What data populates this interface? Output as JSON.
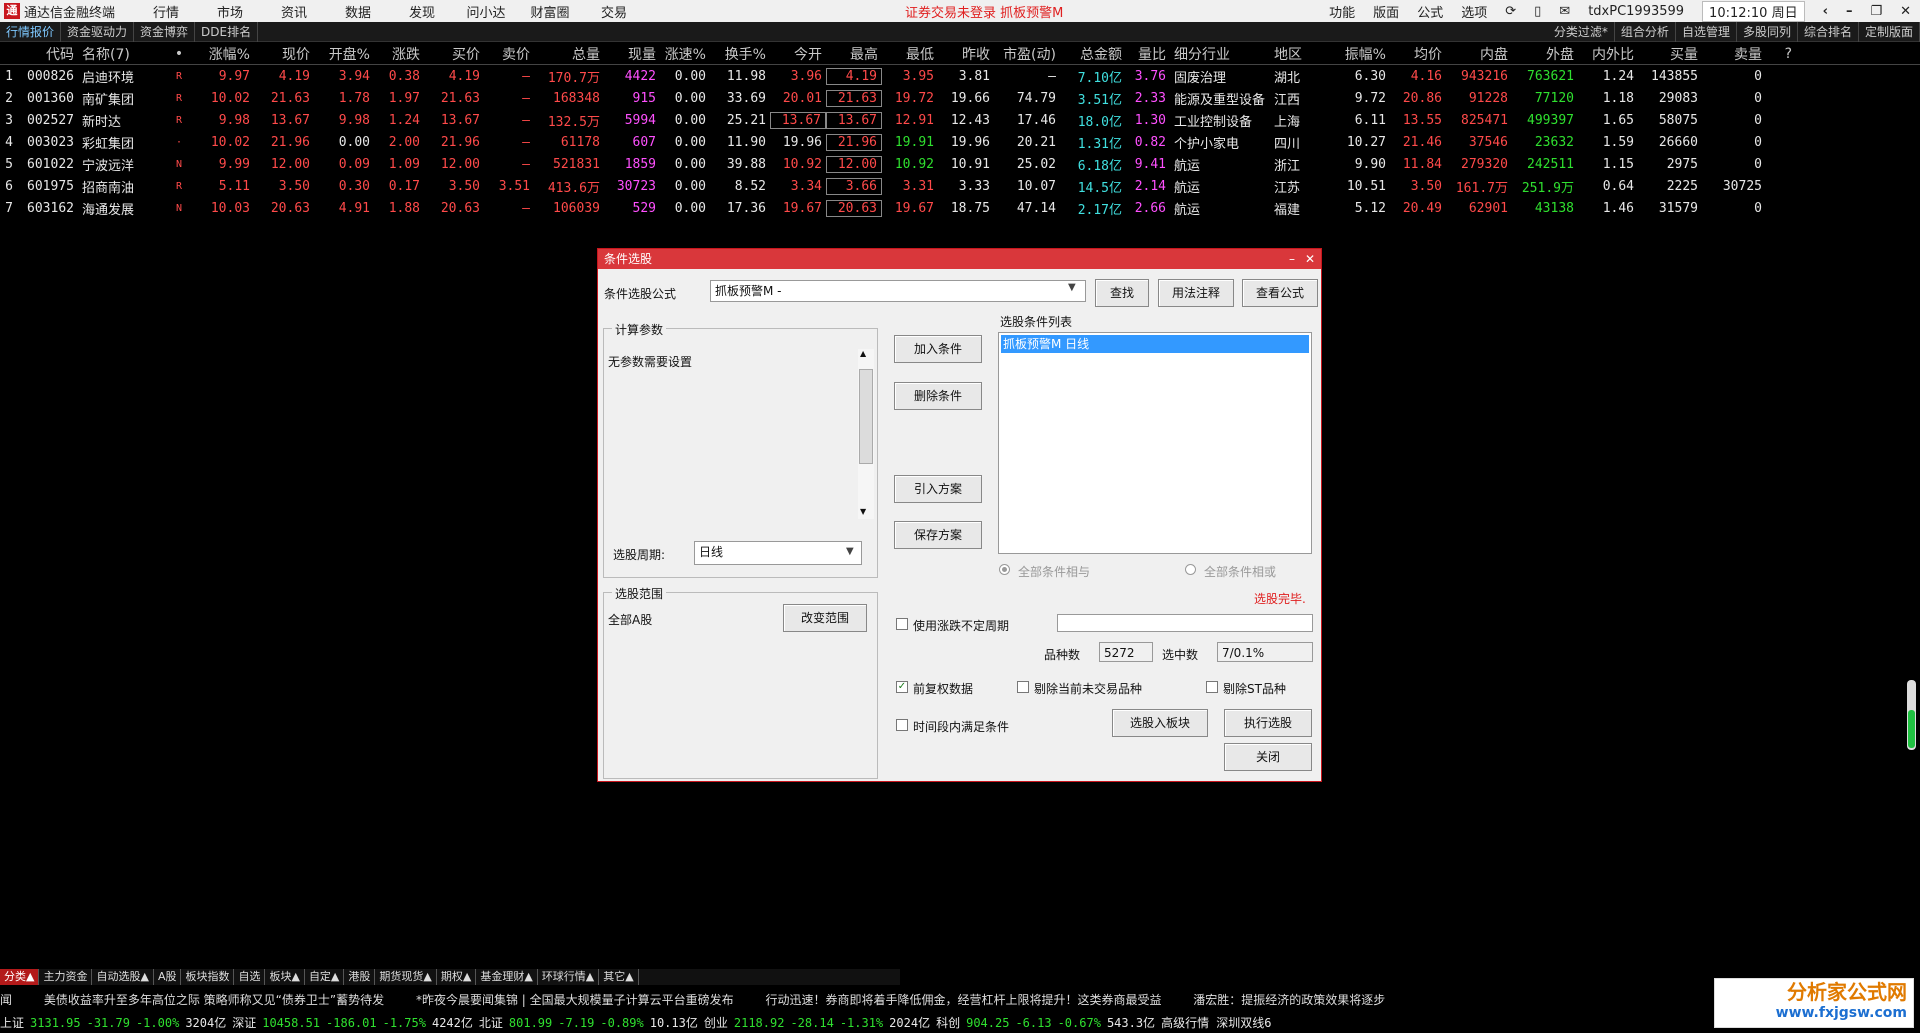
{
  "titlebar": {
    "app_name": "通达信金融终端",
    "menus": [
      "行情",
      "市场",
      "资讯",
      "数据",
      "发现",
      "问小达",
      "财富圈",
      "交易"
    ],
    "status": "证券交易未登录   抓板预警M",
    "right_items": [
      "功能",
      "版面",
      "公式",
      "选项"
    ],
    "user": "tdxPC1993599",
    "clock": "10:12:10 周日"
  },
  "subbar": {
    "tabs": [
      "行情报价",
      "资金驱动力",
      "资金博弈",
      "DDE排名"
    ],
    "right_tabs": [
      "分类过滤*",
      "组合分析",
      "自选管理",
      "多股同列",
      "综合排名",
      "定制版面"
    ]
  },
  "table": {
    "headers": [
      "",
      "代码",
      "名称(7)",
      "•",
      "涨幅%",
      "现价",
      "开盘%",
      "涨跌",
      "买价",
      "卖价",
      "总量",
      "现量",
      "涨速%",
      "换手%",
      "今开",
      "最高",
      "最低",
      "昨收",
      "市盈(动)",
      "总金额",
      "量比",
      "细分行业",
      "地区",
      "振幅%",
      "均价",
      "内盘",
      "外盘",
      "内外比",
      "买量",
      "卖量",
      "?"
    ],
    "rows": [
      [
        "1",
        "000826",
        "启迪环境",
        "R",
        "9.97",
        "4.19",
        "3.94",
        "0.38",
        "4.19",
        "–",
        "170.7万",
        "4422",
        "0.00",
        "11.98",
        "3.96",
        "4.19",
        "3.95",
        "3.81",
        "–",
        "7.10亿",
        "3.76",
        "固废治理",
        "湖北",
        "6.30",
        "4.16",
        "943216",
        "763621",
        "1.24",
        "143855",
        "0"
      ],
      [
        "2",
        "001360",
        "南矿集团",
        "R",
        "10.02",
        "21.63",
        "1.78",
        "1.97",
        "21.63",
        "–",
        "168348",
        "915",
        "0.00",
        "33.69",
        "20.01",
        "21.63",
        "19.72",
        "19.66",
        "74.79",
        "3.51亿",
        "2.33",
        "能源及重型设备",
        "江西",
        "9.72",
        "20.86",
        "91228",
        "77120",
        "1.18",
        "29083",
        "0"
      ],
      [
        "3",
        "002527",
        "新时达",
        "R",
        "9.98",
        "13.67",
        "9.98",
        "1.24",
        "13.67",
        "–",
        "132.5万",
        "5994",
        "0.00",
        "25.21",
        "13.67",
        "13.67",
        "12.91",
        "12.43",
        "17.46",
        "18.0亿",
        "1.30",
        "工业控制设备",
        "上海",
        "6.11",
        "13.55",
        "825471",
        "499397",
        "1.65",
        "58075",
        "0"
      ],
      [
        "4",
        "003023",
        "彩虹集团",
        "·",
        "10.02",
        "21.96",
        "0.00",
        "2.00",
        "21.96",
        "–",
        "61178",
        "607",
        "0.00",
        "11.90",
        "19.96",
        "21.96",
        "19.91",
        "19.96",
        "20.21",
        "1.31亿",
        "0.82",
        "个护小家电",
        "四川",
        "10.27",
        "21.46",
        "37546",
        "23632",
        "1.59",
        "26660",
        "0"
      ],
      [
        "5",
        "601022",
        "宁波远洋",
        "N",
        "9.99",
        "12.00",
        "0.09",
        "1.09",
        "12.00",
        "–",
        "521831",
        "1859",
        "0.00",
        "39.88",
        "10.92",
        "12.00",
        "10.92",
        "10.91",
        "25.02",
        "6.18亿",
        "9.41",
        "航运",
        "浙江",
        "9.90",
        "11.84",
        "279320",
        "242511",
        "1.15",
        "2975",
        "0"
      ],
      [
        "6",
        "601975",
        "招商南油",
        "R",
        "5.11",
        "3.50",
        "0.30",
        "0.17",
        "3.50",
        "3.51",
        "413.6万",
        "30723",
        "0.00",
        "8.52",
        "3.34",
        "3.66",
        "3.31",
        "3.33",
        "10.07",
        "14.5亿",
        "2.14",
        "航运",
        "江苏",
        "10.51",
        "3.50",
        "161.7万",
        "251.9万",
        "0.64",
        "2225",
        "30725"
      ],
      [
        "7",
        "603162",
        "海通发展",
        "N",
        "10.03",
        "20.63",
        "4.91",
        "1.88",
        "20.63",
        "–",
        "106039",
        "529",
        "0.00",
        "17.36",
        "19.67",
        "20.63",
        "19.67",
        "18.75",
        "47.14",
        "2.17亿",
        "2.66",
        "航运",
        "福建",
        "5.12",
        "20.49",
        "62901",
        "43138",
        "1.46",
        "31579",
        "0"
      ]
    ]
  },
  "dialog": {
    "title": "条件选股",
    "formula_label": "条件选股公式",
    "formula_value": "抓板预警M  -",
    "btn_find": "查找",
    "btn_usage": "用法注释",
    "btn_view": "查看公式",
    "params_group": "计算参数",
    "params_text": "无参数需要设置",
    "period_label": "选股周期:",
    "period_value": "日线",
    "btn_add": "加入条件",
    "btn_delete": "删除条件",
    "btn_import": "引入方案",
    "btn_save": "保存方案",
    "list_label": "选股条件列表",
    "list_item": "抓板预警M  日线",
    "radio_and": "全部条件相与",
    "radio_or": "全部条件相或",
    "done_text": "选股完毕.",
    "range_group": "选股范围",
    "range_value": "全部A股",
    "btn_change_range": "改变范围",
    "chk_variable_period": "使用涨跌不定周期",
    "count_label": "品种数",
    "count_value": "5272",
    "selected_label": "选中数",
    "selected_value": "7/0.1%",
    "chk_fq": "前复权数据",
    "chk_remove_untraded": "剔除当前未交易品种",
    "chk_remove_st": "剔除ST品种",
    "chk_time_range": "时间段内满足条件",
    "btn_to_block": "选股入板块",
    "btn_execute": "执行选股",
    "btn_close": "关闭"
  },
  "bottom_tabs": [
    "分类▲",
    "主力资金",
    "自动选股▲",
    "A股",
    "板块指数",
    "自选",
    "板块▲",
    "自定▲",
    "港股",
    "期货现货▲",
    "期权▲",
    "基金理财▲",
    "环球行情▲",
    "其它▲"
  ],
  "news": [
    "闻",
    "美债收益率升至多年高位之际  策略师称又见“债券卫士”蓄势待发",
    "*昨夜今晨要闻集锦  |  全国最大规模量子计算云平台重磅发布",
    "行动迅速！券商即将着手降低佣金，经营杠杆上限将提升！这类券商最受益",
    "潘宏胜：提振经济的政策效果将逐步"
  ],
  "index_bar": [
    {
      "name": "上证",
      "value": "3131.95",
      "chg": "-31.79",
      "pct": "-1.00%",
      "amt": "3204亿"
    },
    {
      "name": "深证",
      "value": "10458.51",
      "chg": "-186.01",
      "pct": "-1.75%",
      "amt": "4242亿"
    },
    {
      "name": "北证",
      "value": "801.99",
      "chg": "-7.19",
      "pct": "-0.89%",
      "amt": "10.13亿"
    },
    {
      "name": "创业",
      "value": "2118.92",
      "chg": "-28.14",
      "pct": "-1.31%",
      "amt": "2024亿"
    },
    {
      "name": "科创",
      "value": "904.25",
      "chg": "-6.13",
      "pct": "-0.67%",
      "amt": "543.3亿"
    }
  ],
  "index_tail": "高级行情  深圳双线6",
  "brand": {
    "name": "分析家公式网",
    "url": "www.fxjgsw.com"
  }
}
